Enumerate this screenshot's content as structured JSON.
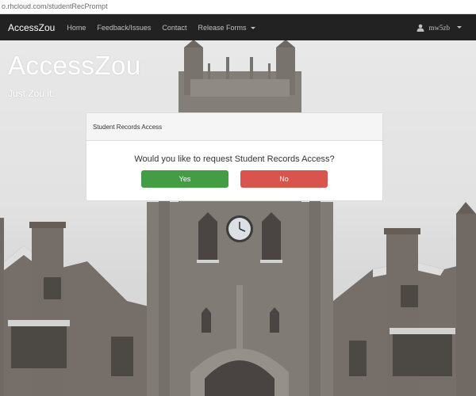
{
  "browser": {
    "address": "o.rhcloud.com/studentRecPrompt"
  },
  "navbar": {
    "brand": "AccessZou",
    "links": [
      "Home",
      "Feedback/Issues",
      "Contact",
      "Release Forms"
    ],
    "user": "mw5zb"
  },
  "hero": {
    "title": "AccessZou",
    "subtitle": "Just Zou it."
  },
  "panel": {
    "heading": "Student Records Access",
    "question": "Would you like to request Student Records Access?",
    "yes_label": "Yes",
    "no_label": "No"
  },
  "colors": {
    "navbar": "#222222",
    "yes": "#449d44",
    "no": "#d9534f"
  }
}
